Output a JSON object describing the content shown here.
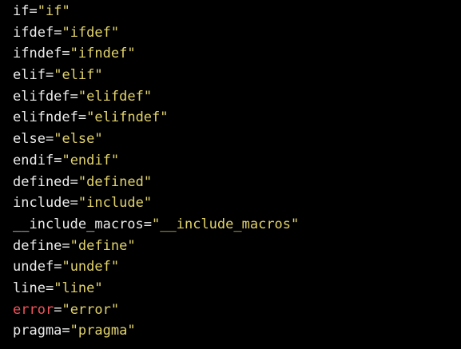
{
  "colors": {
    "background": "#000000",
    "key": "#ececec",
    "key_error": "#f2545b",
    "string": "#e2d36b"
  },
  "lines": [
    {
      "key": "if",
      "value": "if",
      "error": false
    },
    {
      "key": "ifdef",
      "value": "ifdef",
      "error": false
    },
    {
      "key": "ifndef",
      "value": "ifndef",
      "error": false
    },
    {
      "key": "elif",
      "value": "elif",
      "error": false
    },
    {
      "key": "elifdef",
      "value": "elifdef",
      "error": false
    },
    {
      "key": "elifndef",
      "value": "elifndef",
      "error": false
    },
    {
      "key": "else",
      "value": "else",
      "error": false
    },
    {
      "key": "endif",
      "value": "endif",
      "error": false
    },
    {
      "key": "defined",
      "value": "defined",
      "error": false
    },
    {
      "key": "include",
      "value": "include",
      "error": false
    },
    {
      "key": "__include_macros",
      "value": "__include_macros",
      "error": false
    },
    {
      "key": "define",
      "value": "define",
      "error": false
    },
    {
      "key": "undef",
      "value": "undef",
      "error": false
    },
    {
      "key": "line",
      "value": "line",
      "error": false
    },
    {
      "key": "error",
      "value": "error",
      "error": true
    },
    {
      "key": "pragma",
      "value": "pragma",
      "error": false
    }
  ]
}
